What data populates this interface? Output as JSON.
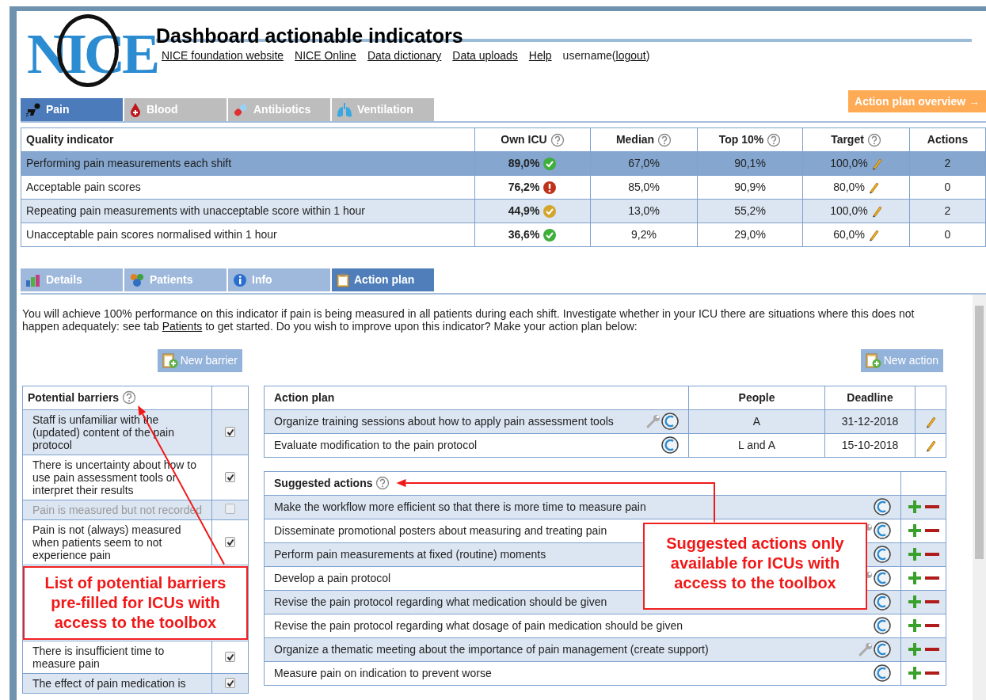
{
  "header": {
    "logo": "NICE",
    "title": "Dashboard actionable indicators",
    "links": [
      "NICE foundation website",
      "NICE Online",
      "Data dictionary",
      "Data uploads",
      "Help"
    ],
    "user": {
      "before": "username(",
      "link": "logout",
      "after": ")"
    }
  },
  "overview_button": "Action plan overview →",
  "tabs": [
    {
      "label": "Pain",
      "selected": true
    },
    {
      "label": "Blood",
      "selected": false
    },
    {
      "label": "Antibiotics",
      "selected": false
    },
    {
      "label": "Ventilation",
      "selected": false
    }
  ],
  "indicators": {
    "columns": [
      {
        "label": "Quality indicator",
        "help": false
      },
      {
        "label": "Own ICU",
        "help": true
      },
      {
        "label": "Median",
        "help": true
      },
      {
        "label": "Top 10%",
        "help": true
      },
      {
        "label": "Target",
        "help": true
      },
      {
        "label": "Actions",
        "help": false
      }
    ],
    "rows": [
      {
        "name": "Performing pain measurements each shift",
        "own": "89,0%",
        "kind": "ok",
        "median": "67,0%",
        "top10": "90,1%",
        "target": "100,0%",
        "actions": "2",
        "selected": true
      },
      {
        "name": "Acceptable pain scores",
        "own": "76,2%",
        "kind": "alert",
        "median": "85,0%",
        "top10": "90,9%",
        "target": "80,0%",
        "actions": "0",
        "selected": false
      },
      {
        "name": "Repeating pain measurements with unacceptable score within 1 hour",
        "own": "44,9%",
        "kind": "partial",
        "median": "13,0%",
        "top10": "55,2%",
        "target": "100,0%",
        "actions": "2",
        "selected": false
      },
      {
        "name": "Unacceptable pain scores normalised within 1 hour",
        "own": "36,6%",
        "kind": "ok",
        "median": "9,2%",
        "top10": "29,0%",
        "target": "60,0%",
        "actions": "0",
        "selected": false
      }
    ]
  },
  "subtabs": [
    {
      "label": "Details",
      "selected": false
    },
    {
      "label": "Patients",
      "selected": false
    },
    {
      "label": "Info",
      "selected": false
    },
    {
      "label": "Action plan",
      "selected": true
    }
  ],
  "intro": {
    "before": "You will achieve 100% performance on this indicator if pain is being measured in all patients during each shift. Investigate whether in your ICU there are situations where this does not happen adequately: see tab ",
    "link": "Patients",
    "after": " to get started. Do you wish to improve upon this indicator? Make your action plan below:"
  },
  "new_barrier": "New barrier",
  "new_action": "New action",
  "barriers": {
    "title": "Potential barriers",
    "rows": [
      {
        "text": "Staff is unfamiliar with the (updated) content of the pain protocol",
        "checked": true,
        "disabled": false
      },
      {
        "text": "There is uncertainty about how to use pain assessment tools or interpret their results",
        "checked": true,
        "disabled": false
      },
      {
        "text": "Pain is measured but not recorded",
        "checked": false,
        "disabled": true
      },
      {
        "text": "Pain is not (always) measured when patients seem to not experience pain",
        "checked": true,
        "disabled": false
      },
      {
        "text": "There is insufficient time to measure pain",
        "checked": true,
        "disabled": false
      },
      {
        "text": "The effect of pain medication is",
        "checked": true,
        "disabled": false
      }
    ]
  },
  "action_plan": {
    "columns": [
      "Action plan",
      "People",
      "Deadline"
    ],
    "rows": [
      {
        "text": "Organize training sessions about how to apply pain assessment tools",
        "tool": true,
        "people": "A",
        "deadline": "31-12-2018"
      },
      {
        "text": "Evaluate modification to the pain protocol",
        "tool": false,
        "people": "L and A",
        "deadline": "15-10-2018"
      }
    ]
  },
  "suggested": {
    "title": "Suggested actions",
    "rows": [
      {
        "text": "Make the workflow more efficient so that there is more time to measure pain",
        "tool": false
      },
      {
        "text": "Disseminate promotional posters about measuring and treating pain",
        "tool": true
      },
      {
        "text": "Perform pain measurements at fixed (routine) moments",
        "tool": false
      },
      {
        "text": "Develop a pain protocol",
        "tool": true
      },
      {
        "text": "Revise the pain protocol regarding what medication should be given",
        "tool": false
      },
      {
        "text": "Revise the pain protocol regarding what dosage of pain medication should be given",
        "tool": false
      },
      {
        "text": "Organize a thematic meeting about the importance of pain management (create support)",
        "tool": true
      },
      {
        "text": "Measure pain on indication to prevent worse",
        "tool": false
      }
    ]
  },
  "annotations": [
    {
      "text": "List of potential barriers pre-filled for ICUs with access to the toolbox"
    },
    {
      "text": "Suggested actions only available for ICUs with access to the toolbox"
    }
  ]
}
